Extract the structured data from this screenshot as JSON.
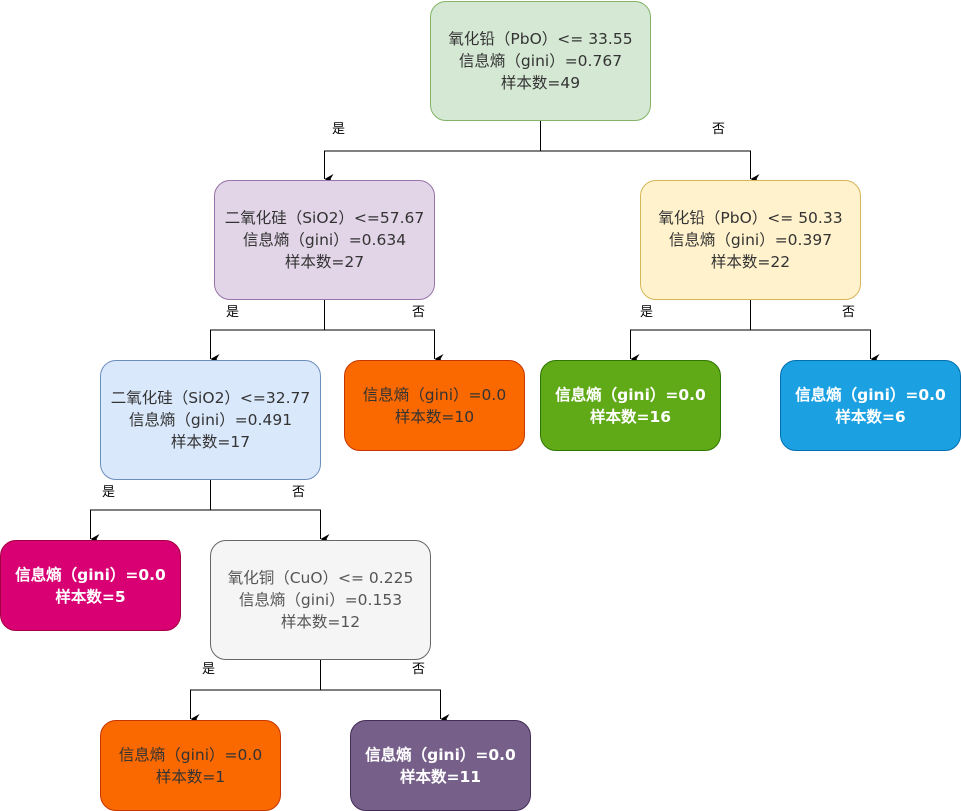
{
  "nodes": [
    {
      "id": "n0",
      "lines": [
        "氧化铅（PbO）<= 33.55",
        "信息熵（gini）=0.767",
        "样本数=49"
      ],
      "fill": "#d5e8d4",
      "stroke": "#82b366",
      "leaf": false
    },
    {
      "id": "n1",
      "lines": [
        "二氧化硅（SiO2）<=57.67",
        "信息熵（gini）=0.634",
        "样本数=27"
      ],
      "fill": "#e1d5e7",
      "stroke": "#9673a6",
      "leaf": false
    },
    {
      "id": "n2",
      "lines": [
        "氧化铅（PbO）<= 50.33",
        "信息熵（gini）=0.397",
        "样本数=22"
      ],
      "fill": "#fff2cc",
      "stroke": "#d6b656",
      "leaf": false
    },
    {
      "id": "n3",
      "lines": [
        "二氧化硅（SiO2）<=32.77",
        "信息熵（gini）=0.491",
        "样本数=17"
      ],
      "fill": "#dae8fc",
      "stroke": "#6c8ebf",
      "leaf": false
    },
    {
      "id": "n4",
      "lines": [
        "信息熵（gini）=0.0",
        "样本数=10"
      ],
      "fill": "#fa6800",
      "stroke": "#c73500",
      "leaf": false
    },
    {
      "id": "n5",
      "lines": [
        "信息熵（gini）=0.0",
        "样本数=16"
      ],
      "fill": "#60a917",
      "stroke": "#2d7600",
      "leaf": true
    },
    {
      "id": "n6",
      "lines": [
        "信息熵（gini）=0.0",
        "样本数=6"
      ],
      "fill": "#1ba1e2",
      "stroke": "#006eaf",
      "leaf": true
    },
    {
      "id": "n7",
      "lines": [
        "信息熵（gini）=0.0",
        "样本数=5"
      ],
      "fill": "#d80073",
      "stroke": "#a50040",
      "leaf": true
    },
    {
      "id": "n8",
      "lines": [
        "氧化铜（CuO）<= 0.225",
        "信息熵（gini）=0.153",
        "样本数=12"
      ],
      "fill": "#f5f5f5",
      "stroke": "#666666",
      "leaf": false,
      "color": "#555555"
    },
    {
      "id": "n9",
      "lines": [
        "信息熵（gini）=0.0",
        "样本数=1"
      ],
      "fill": "#fa6800",
      "stroke": "#c73500",
      "leaf": false
    },
    {
      "id": "n10",
      "lines": [
        "信息熵（gini）=0.0",
        "样本数=11"
      ],
      "fill": "#76608a",
      "stroke": "#432d57",
      "leaf": true
    }
  ],
  "edges": [
    {
      "from": "n0",
      "to": "n1",
      "label": "是"
    },
    {
      "from": "n0",
      "to": "n2",
      "label": "否"
    },
    {
      "from": "n1",
      "to": "n3",
      "label": "是"
    },
    {
      "from": "n1",
      "to": "n4",
      "label": "否"
    },
    {
      "from": "n2",
      "to": "n5",
      "label": "是"
    },
    {
      "from": "n2",
      "to": "n6",
      "label": "否"
    },
    {
      "from": "n3",
      "to": "n7",
      "label": "是"
    },
    {
      "from": "n3",
      "to": "n8",
      "label": "否"
    },
    {
      "from": "n8",
      "to": "n9",
      "label": "是"
    },
    {
      "from": "n8",
      "to": "n10",
      "label": "否"
    }
  ]
}
